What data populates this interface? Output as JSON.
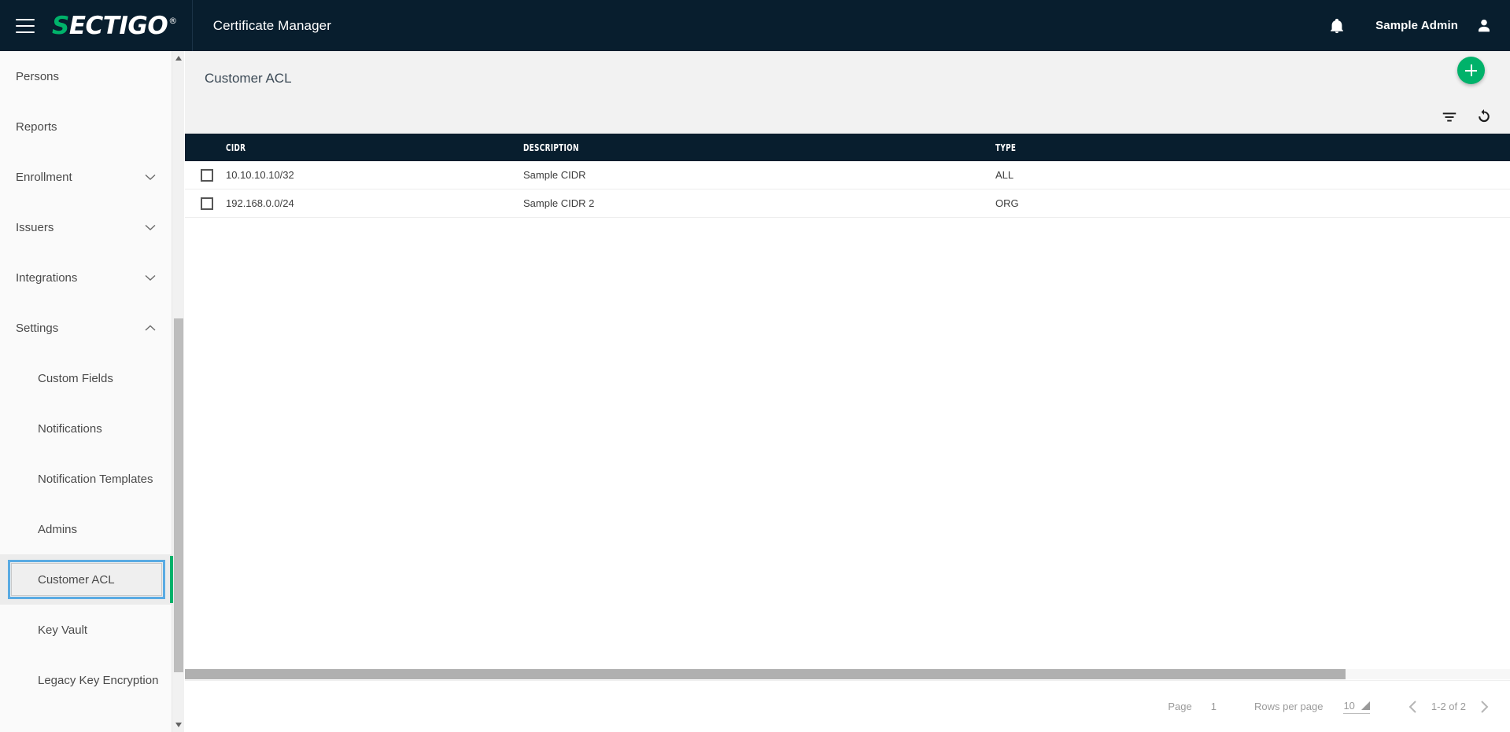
{
  "topbar": {
    "menu_icon": "hamburger-menu-icon",
    "logo_first_letter": "S",
    "logo_rest": "ECTIGO",
    "logo_registered": "®",
    "app_title": "Certificate Manager",
    "bell_icon": "notification-bell-icon",
    "user_name": "Sample Admin",
    "avatar_icon": "user-avatar-icon",
    "bg_color": "#081e2e",
    "brand_green": "#00b26a"
  },
  "sidebar": {
    "items": [
      {
        "label": "Persons",
        "level": "top",
        "expandable": false,
        "expanded": false,
        "selected": false
      },
      {
        "label": "Reports",
        "level": "top",
        "expandable": false,
        "expanded": false,
        "selected": false
      },
      {
        "label": "Enrollment",
        "level": "top",
        "expandable": true,
        "expanded": false,
        "selected": false
      },
      {
        "label": "Issuers",
        "level": "top",
        "expandable": true,
        "expanded": false,
        "selected": false
      },
      {
        "label": "Integrations",
        "level": "top",
        "expandable": true,
        "expanded": false,
        "selected": false
      },
      {
        "label": "Settings",
        "level": "top",
        "expandable": true,
        "expanded": true,
        "selected": false
      },
      {
        "label": "Custom Fields",
        "level": "sub",
        "expandable": false,
        "expanded": false,
        "selected": false
      },
      {
        "label": "Notifications",
        "level": "sub",
        "expandable": false,
        "expanded": false,
        "selected": false
      },
      {
        "label": "Notification Templates",
        "level": "sub",
        "expandable": false,
        "expanded": false,
        "selected": false
      },
      {
        "label": "Admins",
        "level": "sub",
        "expandable": false,
        "expanded": false,
        "selected": false
      },
      {
        "label": "Customer ACL",
        "level": "sub",
        "expandable": false,
        "expanded": false,
        "selected": true
      },
      {
        "label": "Key Vault",
        "level": "sub",
        "expandable": false,
        "expanded": false,
        "selected": false
      },
      {
        "label": "Legacy Key Encryption",
        "level": "sub",
        "expandable": false,
        "expanded": false,
        "selected": false
      }
    ],
    "selection_outline_color": "#5aabe3",
    "selection_accent_color": "#00b26a",
    "scrollbar": {
      "up_arrow_icon": "scroll-up-arrow-icon",
      "down_arrow_icon": "scroll-down-arrow-icon"
    }
  },
  "page": {
    "title": "Customer ACL",
    "add_button_icon": "plus-icon",
    "filter_icon": "filter-icon",
    "refresh_icon": "refresh-icon"
  },
  "table": {
    "columns": [
      "CIDR",
      "DESCRIPTION",
      "TYPE"
    ],
    "rows": [
      {
        "checked": false,
        "cidr": "10.10.10.10/32",
        "description": "Sample CIDR",
        "type": "ALL"
      },
      {
        "checked": false,
        "cidr": "192.168.0.0/24",
        "description": "Sample CIDR 2",
        "type": "ORG"
      }
    ]
  },
  "pagination": {
    "page_label": "Page",
    "page_number": "1",
    "rows_per_page_label": "Rows per page",
    "rows_per_page_value": "10",
    "dropdown_icon": "dropdown-triangle-icon",
    "prev_icon": "chevron-left-icon",
    "next_icon": "chevron-right-icon",
    "range_text": "1-2 of 2"
  }
}
